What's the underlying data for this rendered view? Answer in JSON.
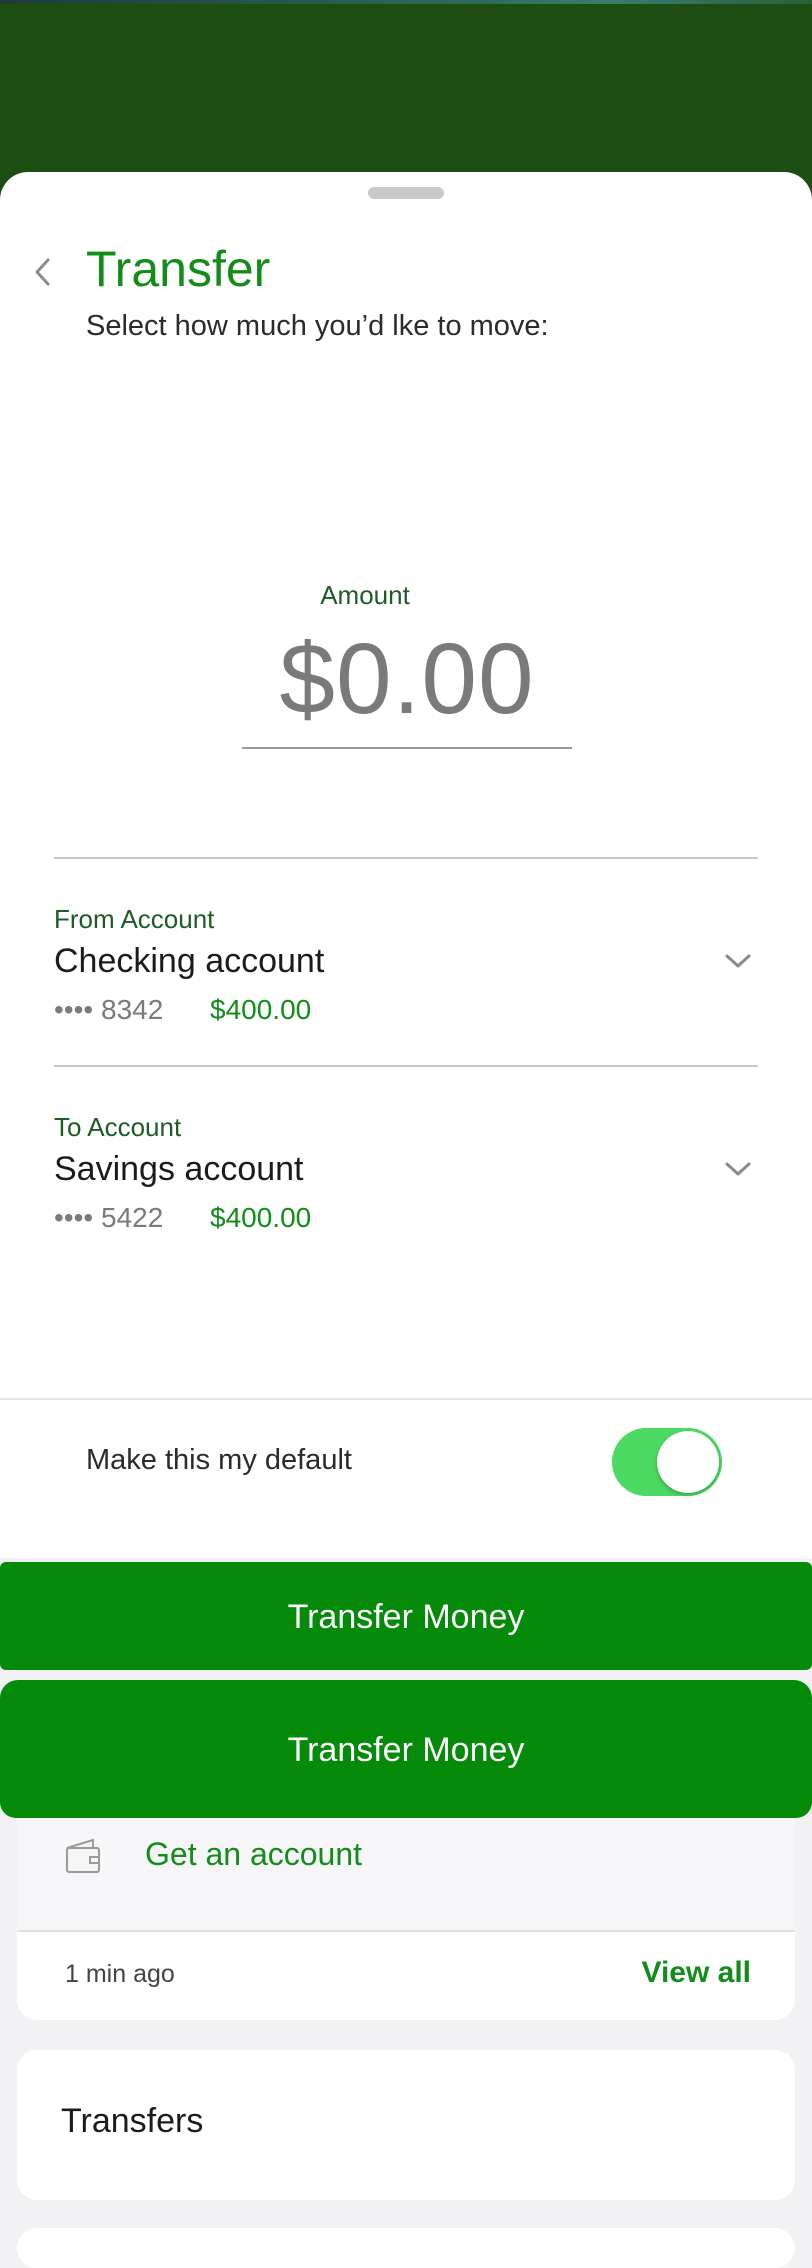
{
  "sheet": {
    "title": "Transfer",
    "subtitle": "Select how much you’d lke to move:",
    "amount": {
      "label": "Amount",
      "value": "$0.00"
    },
    "from_account": {
      "label": "From Account",
      "name": "Checking account",
      "masked_number": "•••• 8342",
      "balance": "$400.00"
    },
    "to_account": {
      "label": "To Account",
      "name": "Savings account",
      "masked_number": "•••• 5422",
      "balance": "$400.00"
    },
    "default_toggle": {
      "label": "Make this my default",
      "on": true
    }
  },
  "buttons": {
    "primary_label": "Transfer Money",
    "secondary_label": "Transfer Money"
  },
  "background": {
    "get_account_label": "Get an account",
    "activity_time": "1 min ago",
    "view_all_label": "View all",
    "transfers_title": "Transfers"
  },
  "icons": [
    "chevron-left-icon",
    "chevron-down-icon",
    "wallet-icon"
  ],
  "colors": {
    "brand_green": "#138c1a",
    "button_green": "#068a0a",
    "toggle_on": "#4cd964",
    "header_band": "#1e4d14"
  }
}
